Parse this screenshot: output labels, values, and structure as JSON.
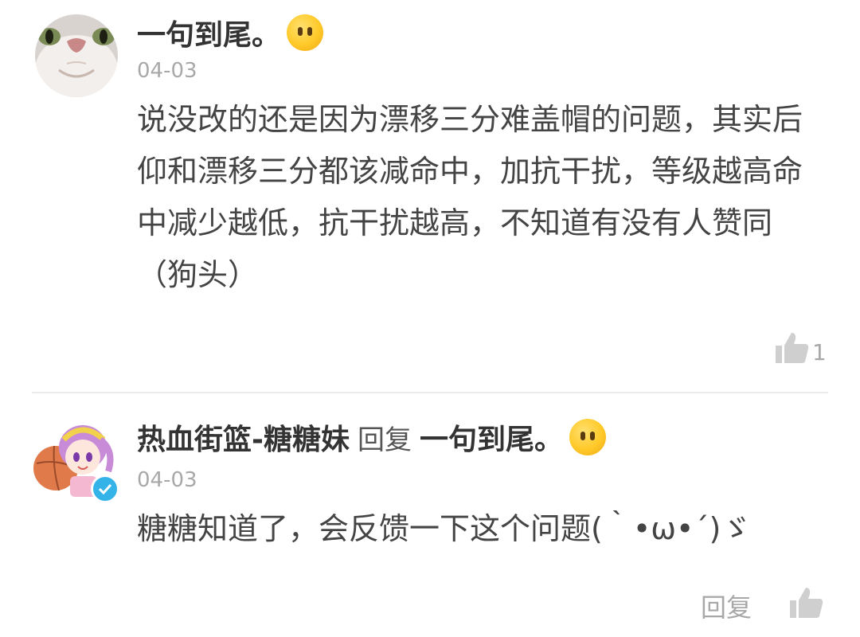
{
  "comments": [
    {
      "username": "一句到尾。",
      "date": "04-03",
      "text": "说没改的还是因为漂移三分难盖帽的问题，其实后仰和漂移三分都该减命中，加抗干扰，等级越高命中减少越低，抗干扰越高，不知道有没有人赞同（狗头）",
      "like_count": "1",
      "icons": {
        "avatar": "cat-face-avatar",
        "emoji": "neutral-face-emoji",
        "like": "thumbs-up-icon"
      }
    },
    {
      "username": "热血街篮-糖糖妹",
      "reply_word": "回复",
      "reply_to": "一句到尾。",
      "date": "04-03",
      "text": "糖糖知道了，会反馈一下这个问题(｀•ω•´)ゞ",
      "reply_action": "回复",
      "icons": {
        "avatar": "anime-girl-basketball-avatar",
        "badge": "verified-badge-icon",
        "like": "thumbs-up-icon"
      }
    }
  ],
  "colors": {
    "username": "#333333",
    "date": "#a8a8a8",
    "text": "#444444",
    "verify_badge": "#34b3e8",
    "emoji": "#ffc928"
  }
}
